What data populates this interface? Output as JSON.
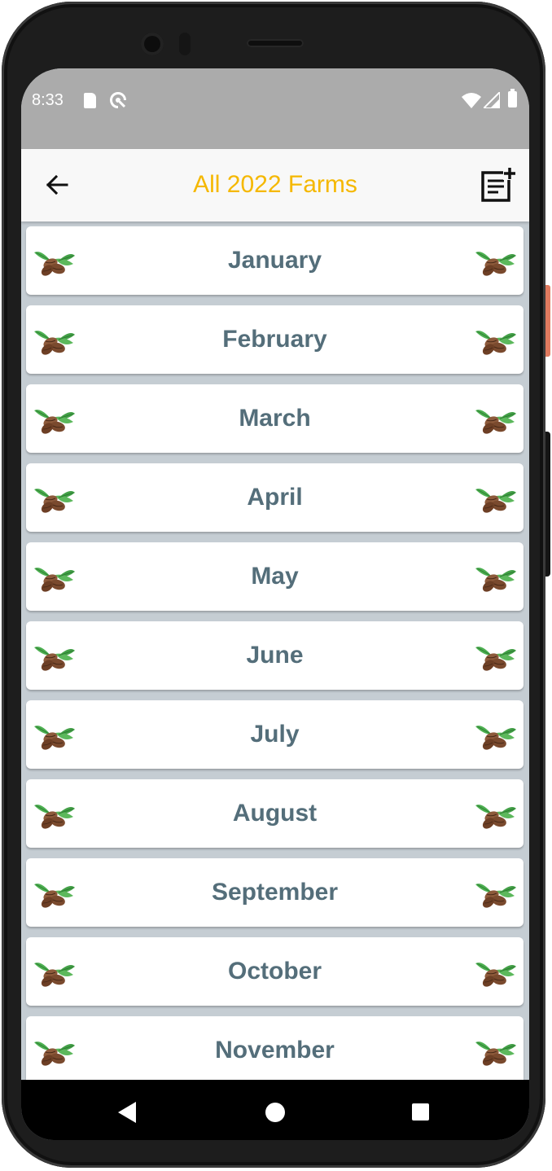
{
  "status_bar": {
    "time": "8:33"
  },
  "app_bar": {
    "title": "All 2022 Farms",
    "title_color": "#f5b800"
  },
  "months": [
    {
      "label": "January"
    },
    {
      "label": "February"
    },
    {
      "label": "March"
    },
    {
      "label": "April"
    },
    {
      "label": "May"
    },
    {
      "label": "June"
    },
    {
      "label": "July"
    },
    {
      "label": "August"
    },
    {
      "label": "September"
    },
    {
      "label": "October"
    },
    {
      "label": "November"
    }
  ],
  "icons": {
    "back": "arrow-left-icon",
    "add_note": "note-add-icon",
    "item": "cocoa-bean-icon"
  },
  "colors": {
    "label": "#546e7a",
    "list_background": "#c5cdd3",
    "status_bar": "#ababab"
  }
}
